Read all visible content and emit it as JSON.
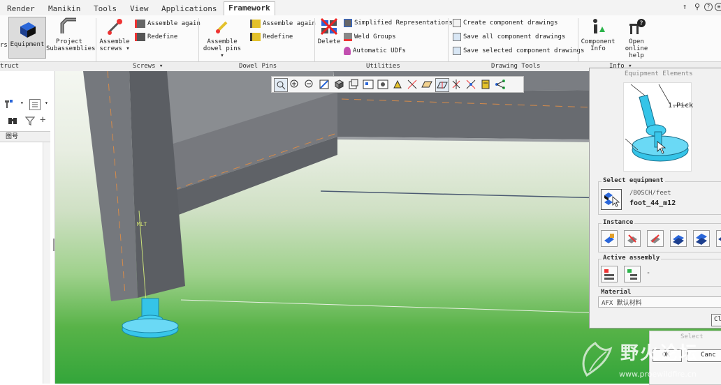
{
  "tabs": [
    "Render",
    "Manikin",
    "Tools",
    "View",
    "Applications",
    "Framework"
  ],
  "active_tab": "Framework",
  "ribbon": {
    "left_clip_label": "rs",
    "equipment": "Equipment",
    "project_sub": [
      "Project",
      "Subassemblies"
    ],
    "assemble_screws": [
      "Assemble",
      "screws ▾"
    ],
    "screws_assemble_again": "Assemble again",
    "screws_redefine": "Redefine",
    "assemble_dowel": [
      "Assemble",
      "dowel pins ▾"
    ],
    "dowel_assemble_again": "Assemble again",
    "dowel_redefine": "Redefine",
    "delete": "Delete",
    "simplified_rep": "Simplified Representations",
    "weld_groups": "Weld Groups",
    "automatic_udfs": "Automatic UDFs",
    "create_drawings": "Create component drawings",
    "save_all_drawings": "Save all component drawings",
    "save_selected_drawings": "Save selected component drawings",
    "component_info": [
      "Component",
      "Info"
    ],
    "open_help": [
      "Open online",
      "help"
    ],
    "groups": {
      "struct": "truct",
      "screws": "Screws ▾",
      "dowel": "Dowel Pins",
      "utilities": "Utilities",
      "drawing": "Drawing Tools",
      "info": "Info ▾"
    }
  },
  "left_panel": {
    "column_label": "图号"
  },
  "viewport": {
    "labels": [
      "MLT"
    ]
  },
  "dialog": {
    "title": "Equipment Elements",
    "preview_label": "1.Pick",
    "select_equipment": "Select equipment",
    "path": "/BOSCH/feet",
    "item": "foot_44_m12",
    "instance": "Instance",
    "active_assembly": "Active assembly",
    "active_assembly_value": "-",
    "material": "Material",
    "material_value": "AFX 默认材料",
    "close_button": "Cl",
    "select_button": "Select",
    "ok_button": "OK",
    "cancel_button": "Canc"
  },
  "watermark": {
    "text": "野火论坛",
    "url": "www.proewildfire.cn"
  },
  "colors": {
    "steel": "#6e7177",
    "steel_light": "#8a8d92",
    "foot_cyan": "#35c4e8",
    "ground_green": "#33a53a"
  }
}
